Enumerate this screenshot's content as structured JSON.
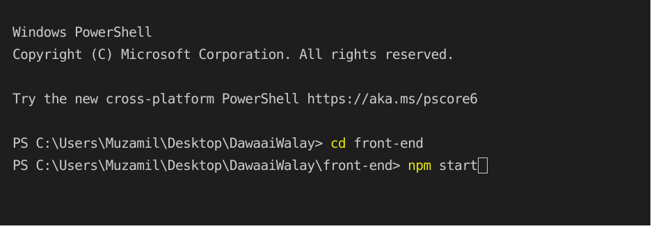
{
  "terminal": {
    "header": "Windows PowerShell",
    "copyright": "Copyright (C) Microsoft Corporation. All rights reserved.",
    "try_message": "Try the new cross-platform PowerShell https://aka.ms/pscore6",
    "history": [
      {
        "prompt": "PS C:\\Users\\Muzamil\\Desktop\\DawaaiWalay> ",
        "command": "cd",
        "args": " front-end"
      },
      {
        "prompt": "PS C:\\Users\\Muzamil\\Desktop\\DawaaiWalay\\front-end> ",
        "command": "npm",
        "args": " start"
      }
    ],
    "colors": {
      "background": "#1e1e1e",
      "text": "#cccccc",
      "command": "#e5e510"
    },
    "cursor_icon": "block-cursor-outline"
  }
}
